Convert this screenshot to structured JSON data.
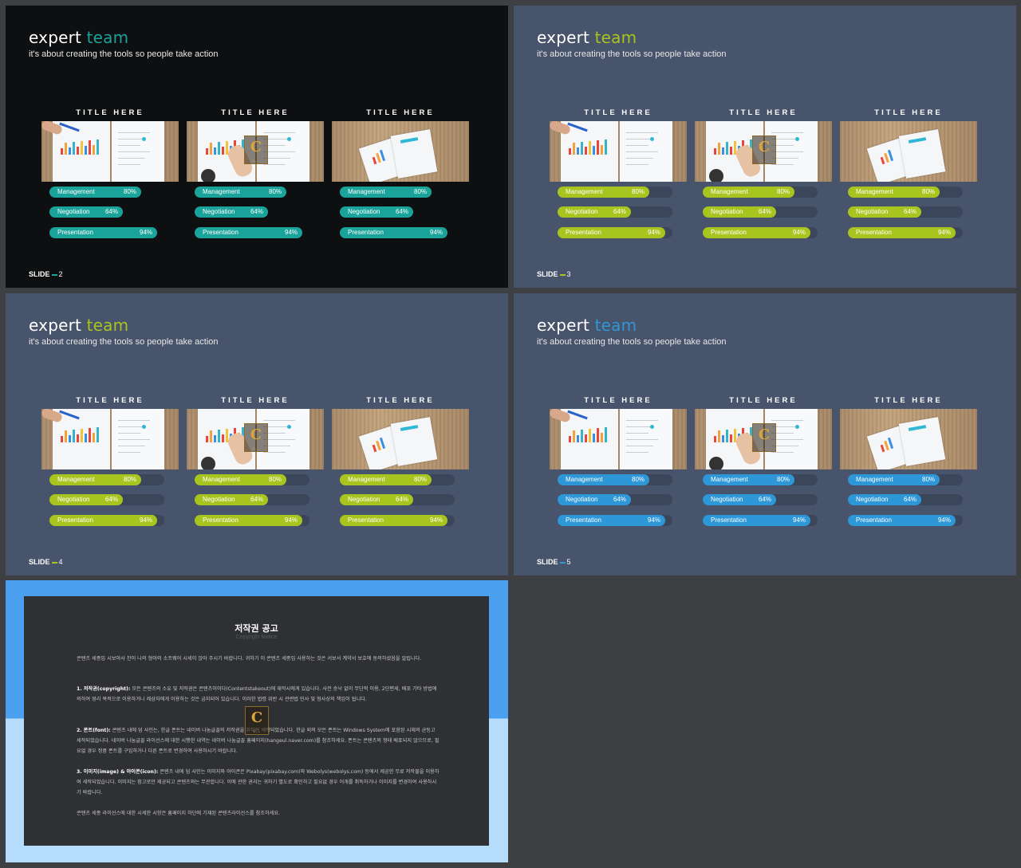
{
  "slides": [
    {
      "bg": "#0e0f10",
      "accent": "#1aa39a",
      "track": "#0e0f10",
      "title_word1": "expert",
      "title_word2": "team",
      "subtitle": "it's about creating the tools so people take action",
      "footer_label": "SLIDE",
      "footer_number": "2"
    },
    {
      "bg": "#48546b",
      "accent": "#a8c41e",
      "track": "#3c465a",
      "title_word1": "expert",
      "title_word2": "team",
      "subtitle": "it's about creating the tools so people take action",
      "footer_label": "SLIDE",
      "footer_number": "3"
    },
    {
      "bg": "#48546b",
      "accent": "#a8c41e",
      "track": "#3c465a",
      "title_word1": "expert",
      "title_word2": "team",
      "subtitle": "it's about creating the tools so people take action",
      "footer_label": "SLIDE",
      "footer_number": "4"
    },
    {
      "bg": "#48546b",
      "accent": "#2d97d8",
      "track": "#3c465a",
      "title_word1": "expert",
      "title_word2": "team",
      "subtitle": "it's about creating the tools so people take action",
      "footer_label": "SLIDE",
      "footer_number": "5"
    }
  ],
  "cards": [
    {
      "title": "TITLE HERE"
    },
    {
      "title": "TITLE HERE"
    },
    {
      "title": "TITLE HERE"
    }
  ],
  "skills": [
    {
      "label": "Management",
      "value": "80%",
      "fraction": 0.8
    },
    {
      "label": "Negotiation",
      "value": "64%",
      "fraction": 0.64
    },
    {
      "label": "Presentation",
      "value": "94%",
      "fraction": 0.94
    }
  ],
  "notice": {
    "title": "저작권 공고",
    "subtitle": "Copyright Notice",
    "intro": "콘텐츠 세종입 시보아사 찬이 나의 형아의 소프웨어 시세이 앉아 주시기 바랍니다. 귀하기 이 콘텐츠 세종입 사용하는 것은 서보서 계약서 보호에 동의하셨음을 알립니다.",
    "s1_head": "1. 저작권(copyright):",
    "s1_body": "모든 콘텐츠의 소유 및 저작권은 콘텐츠이이다(Contentstakeout)에 재작시에게 있습니다. 사전 승낙 없이 무단적 이용, 2단편세, 배포 기타 방법에 의하여 영리 목적으로 이용하거나 제삼자에게 이용하는 것은 금지되어 있습니다. 이러한 법령 위반 시 관련법 민사 및 형사상의 책임이 됩니다.",
    "s2_head": "2. 폰트(font):",
    "s2_body": "콘텐츠 내에 덥 사인는, 한글 폰트는 네이버 나눔글꼴의 저작권을 위하여 세작되었습니다. 한글 외의 모든 폰트는 Windows System에 포함된 시체의 균등고 세작되었습니다. 네이버 나눔글꼴 라이선스에 대한 시행한 내역는 네이버 나눔글꼴 홈페이지(hangeul.naver.com)를 참조하세요. 폰트는 콘텐츠의 형태 배포되지 않으므로, 필요없 경우 정품 폰트를 구입하거나 다른 폰트로 변경하여 사용하시기 바랍니다.",
    "s3_head": "3. 이미지(image) & 아이콘(icon):",
    "s3_body": "콘텐츠 내에 덥 사인는 이미지와 아이콘은 Pixabay(pixabay.com)와 Webolys(webolys.com) 등에서 제공한 무료 저작물을 이용하여 세작되었습니다. 이미지는 참고로만 제공되고 콘텐츠와는 무관합니다. 이에 관한 권리는 귀하기 별도로 확인하고 필요없 경우 어개를 취득하거나 이미지를 변경하여 사용하시기 바랍니다.",
    "outro": "콘텐츠 세종 라이선스에 대한 시세한 시항은 홈페이지 하단에 기재된 콘텐츠라이선스를 참조하세요."
  },
  "watermark": {
    "letter": "C",
    "caption": "C..."
  }
}
